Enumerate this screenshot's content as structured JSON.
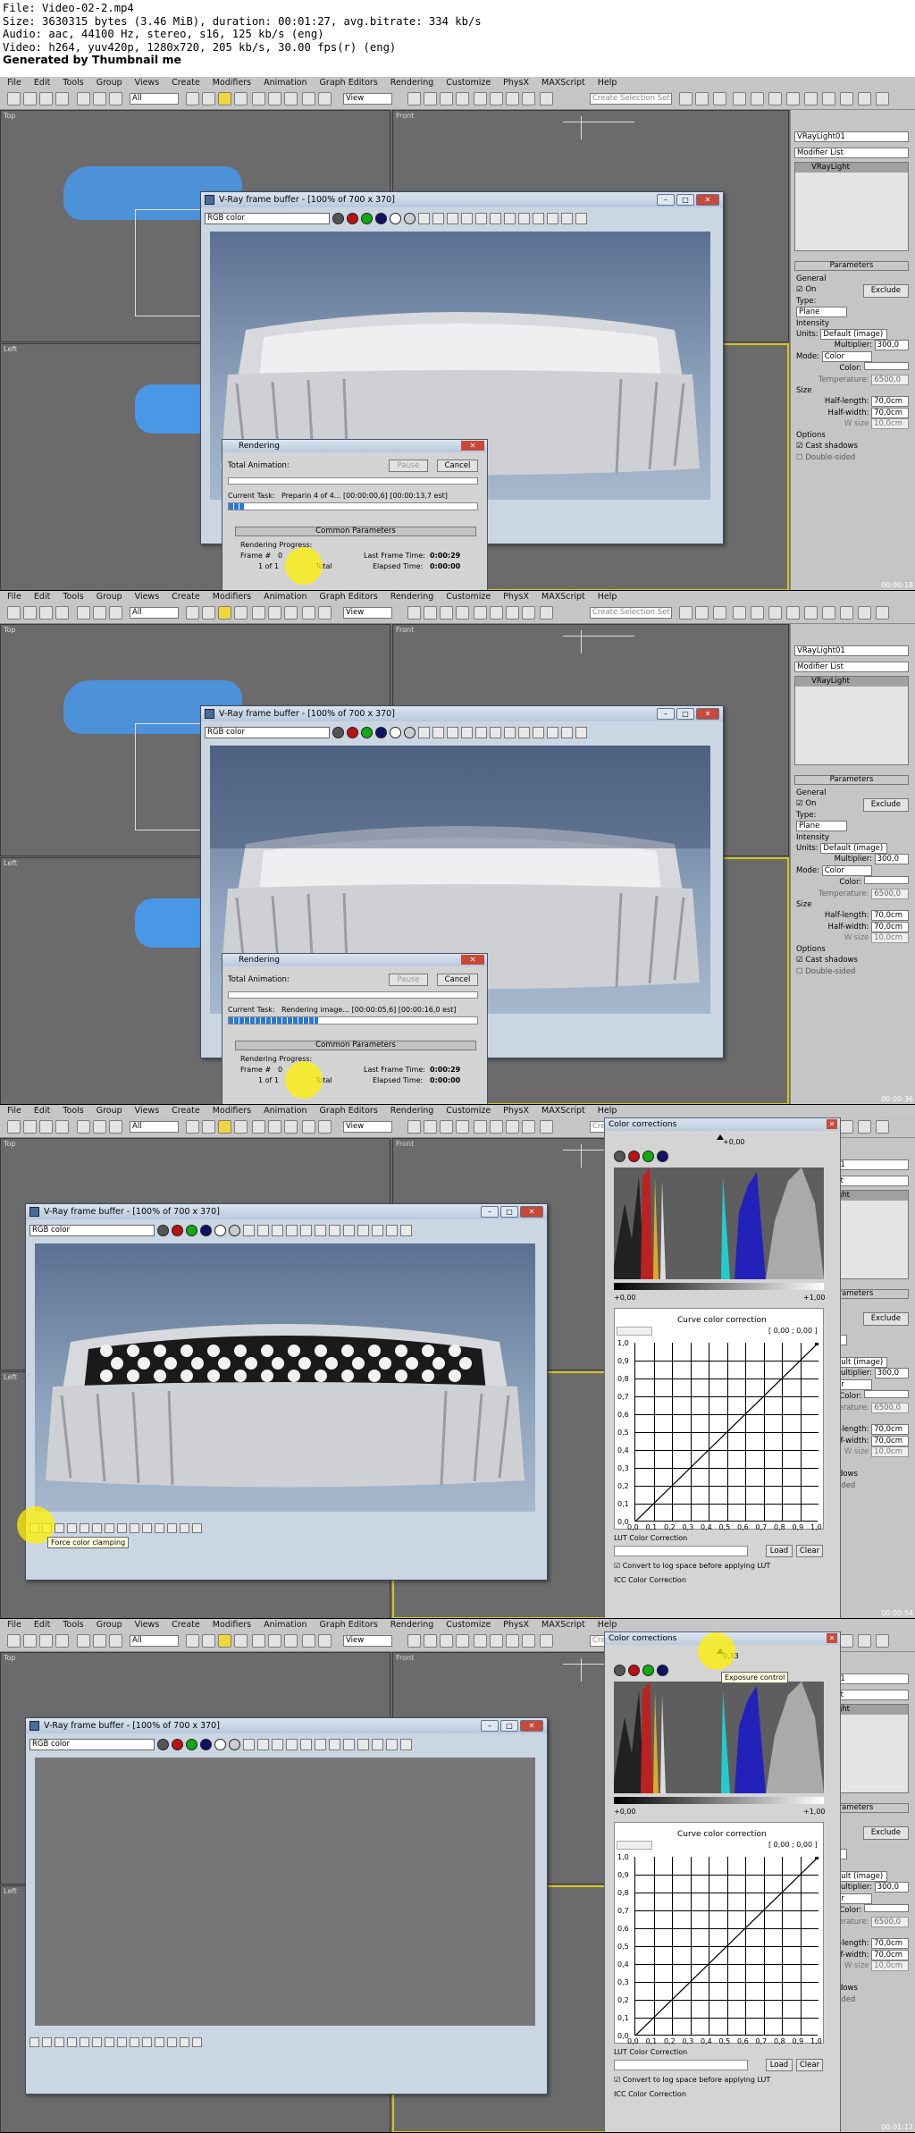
{
  "header": {
    "file": "File: Video-02-2.mp4",
    "size": "Size: 3630315 bytes (3.46 MiB), duration: 00:01:27, avg.bitrate: 334 kb/s",
    "audio": "Audio: aac, 44100 Hz, stereo, s16, 125 kb/s (eng)",
    "video": "Video: h264, yuv420p, 1280x720, 205 kb/s, 30.00 fps(r) (eng)",
    "generated": "Generated by Thumbnail me"
  },
  "app": {
    "menus": [
      "File",
      "Edit",
      "Tools",
      "Group",
      "Views",
      "Create",
      "Modifiers",
      "Animation",
      "Graph Editors",
      "Rendering",
      "Customize",
      "PhysX",
      "MAXScript",
      "Help"
    ],
    "select_filter": "All",
    "view_ref": "View",
    "selection_set": "Create Selection Set",
    "vp_top": "Top",
    "vp_front": "Front",
    "vp_left": "Left",
    "object_name": "VRayLight01",
    "modifier_list": "Modifier List",
    "stack_item": "VRayLight",
    "rollout_parameters": "Parameters",
    "general": "General",
    "on": "On",
    "exclude": "Exclude",
    "type_label": "Type:",
    "type_value": "Plane",
    "intensity": "Intensity",
    "units_label": "Units:",
    "units_value": "Default (image)",
    "multiplier_label": "Multiplier:",
    "multiplier_value": "300,0",
    "mode_label": "Mode:",
    "mode_value": "Color",
    "color_label": "Color:",
    "temperature_label": "Temperature:",
    "temperature_value": "6500,0",
    "size": "Size",
    "half_length_label": "Half-length:",
    "half_length_value": "70,0cm",
    "half_width_label": "Half-width:",
    "half_width_value": "70,0cm",
    "w_size_label": "W size",
    "w_size_value": "10,0cm",
    "options": "Options",
    "cast_shadows": "Cast shadows",
    "double_sided": "Double-sided"
  },
  "vfb": {
    "title": "V-Ray frame buffer - [100% of 700 x 370]",
    "channel": "RGB color",
    "force_clamp_tooltip": "Force color clamping"
  },
  "rendering": {
    "title": "Rendering",
    "total_animation": "Total Animation:",
    "pause": "Pause",
    "cancel": "Cancel",
    "current_task_label": "Current Task:",
    "task_1": "Preparin 4 of 4... [00:00:00,6] [00:00:13,7 est]",
    "task_2": "Rendering image... [00:00:05,6] [00:00:16,0 est]",
    "common_params": "Common Parameters",
    "rendering_progress": "Rendering Progress:",
    "frame_label": "Frame #",
    "frame_value": "0",
    "of_label": "1 of 1",
    "total": "Total",
    "last_frame_time_label": "Last Frame Time:",
    "last_frame_time": "0:00:29",
    "elapsed_time_label": "Elapsed Time:",
    "elapsed_time": "0:00:00",
    "progress_1": 0.06,
    "progress_2": 0.36
  },
  "cc": {
    "title": "Color corrections",
    "exposure_value": "+0,00",
    "exposure_value_b": "0,33",
    "exposure_tooltip": "Exposure control",
    "range_low": "+0,00",
    "range_high": "+1,00",
    "curve_title": "Curve color correction",
    "curve_coords": "[ 0,00 ; 0,00 ]",
    "y_ticks": [
      "1,0",
      "0,9",
      "0,8",
      "0,7",
      "0,6",
      "0,5",
      "0,4",
      "0,3",
      "0,2",
      "0,1",
      "0,0"
    ],
    "x_ticks": [
      "0,0",
      "0,1",
      "0,2",
      "0,3",
      "0,4",
      "0,5",
      "0,6",
      "0,7",
      "0,8",
      "0,9",
      "1,0"
    ],
    "lut_title": "LUT Color Correction",
    "load": "Load",
    "clear": "Clear",
    "convert_log": "Convert to log space before applying LUT",
    "icc_title": "ICC Color Correction"
  },
  "timestamps": [
    "00:00:18",
    "00:00:36",
    "00:00:54",
    "00:01:12"
  ],
  "colors": {
    "accent": "#c7c7c7",
    "cursor": "#ffee00",
    "vfb_bg": "#7e95b2"
  }
}
